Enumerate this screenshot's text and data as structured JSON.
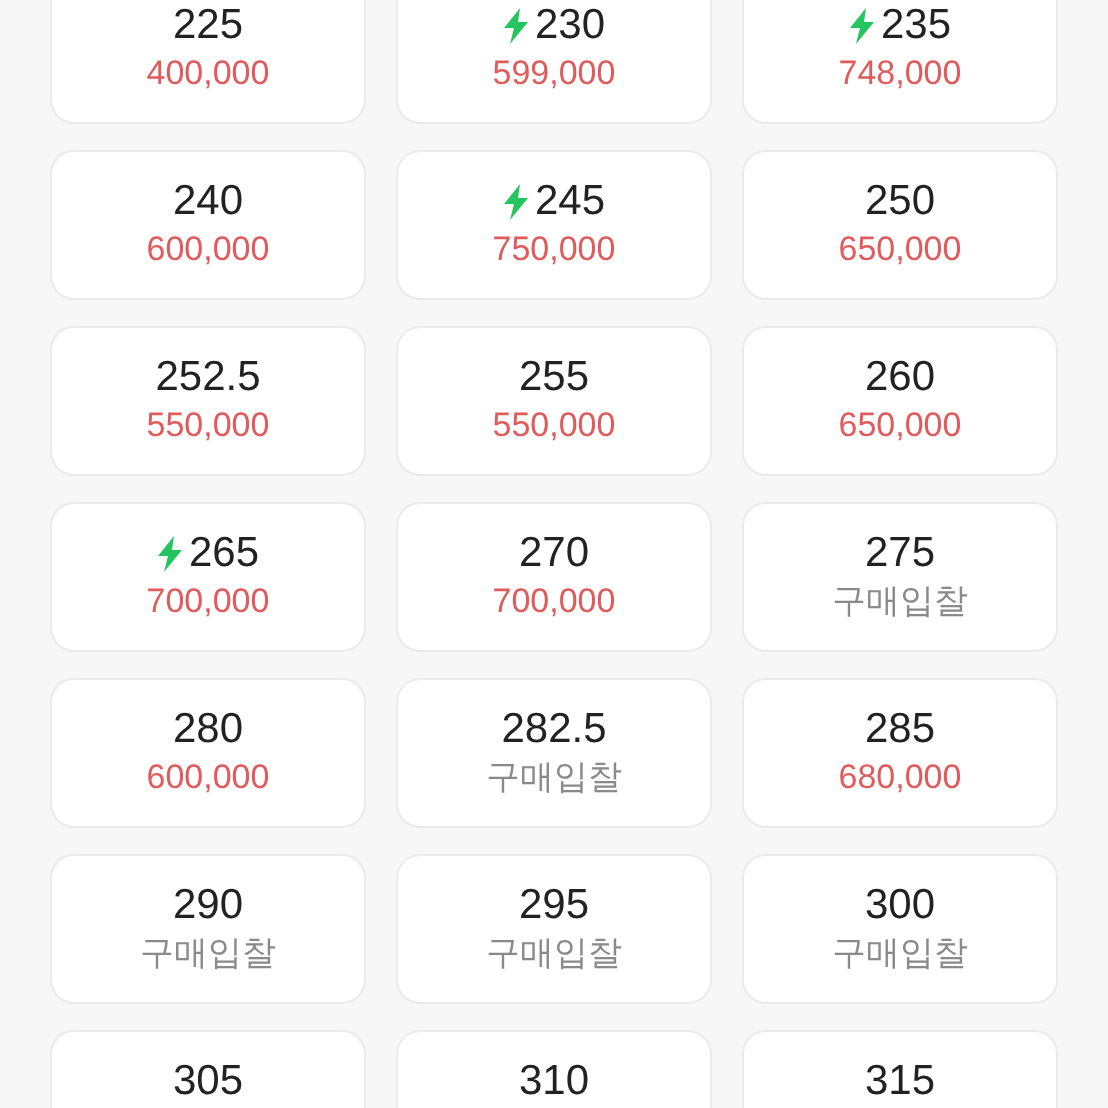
{
  "sizes": [
    {
      "size": "225",
      "express": false,
      "price": "400,000",
      "kind": "price"
    },
    {
      "size": "230",
      "express": true,
      "price": "599,000",
      "kind": "price"
    },
    {
      "size": "235",
      "express": true,
      "price": "748,000",
      "kind": "price"
    },
    {
      "size": "240",
      "express": false,
      "price": "600,000",
      "kind": "price"
    },
    {
      "size": "245",
      "express": true,
      "price": "750,000",
      "kind": "price"
    },
    {
      "size": "250",
      "express": false,
      "price": "650,000",
      "kind": "price"
    },
    {
      "size": "252.5",
      "express": false,
      "price": "550,000",
      "kind": "price"
    },
    {
      "size": "255",
      "express": false,
      "price": "550,000",
      "kind": "price"
    },
    {
      "size": "260",
      "express": false,
      "price": "650,000",
      "kind": "price"
    },
    {
      "size": "265",
      "express": true,
      "price": "700,000",
      "kind": "price"
    },
    {
      "size": "270",
      "express": false,
      "price": "700,000",
      "kind": "price"
    },
    {
      "size": "275",
      "express": false,
      "price": "구매입찰",
      "kind": "bid"
    },
    {
      "size": "280",
      "express": false,
      "price": "600,000",
      "kind": "price"
    },
    {
      "size": "282.5",
      "express": false,
      "price": "구매입찰",
      "kind": "bid"
    },
    {
      "size": "285",
      "express": false,
      "price": "680,000",
      "kind": "price"
    },
    {
      "size": "290",
      "express": false,
      "price": "구매입찰",
      "kind": "bid"
    },
    {
      "size": "295",
      "express": false,
      "price": "구매입찰",
      "kind": "bid"
    },
    {
      "size": "300",
      "express": false,
      "price": "구매입찰",
      "kind": "bid"
    },
    {
      "size": "305",
      "express": false
    },
    {
      "size": "310",
      "express": false
    },
    {
      "size": "315",
      "express": false
    }
  ]
}
